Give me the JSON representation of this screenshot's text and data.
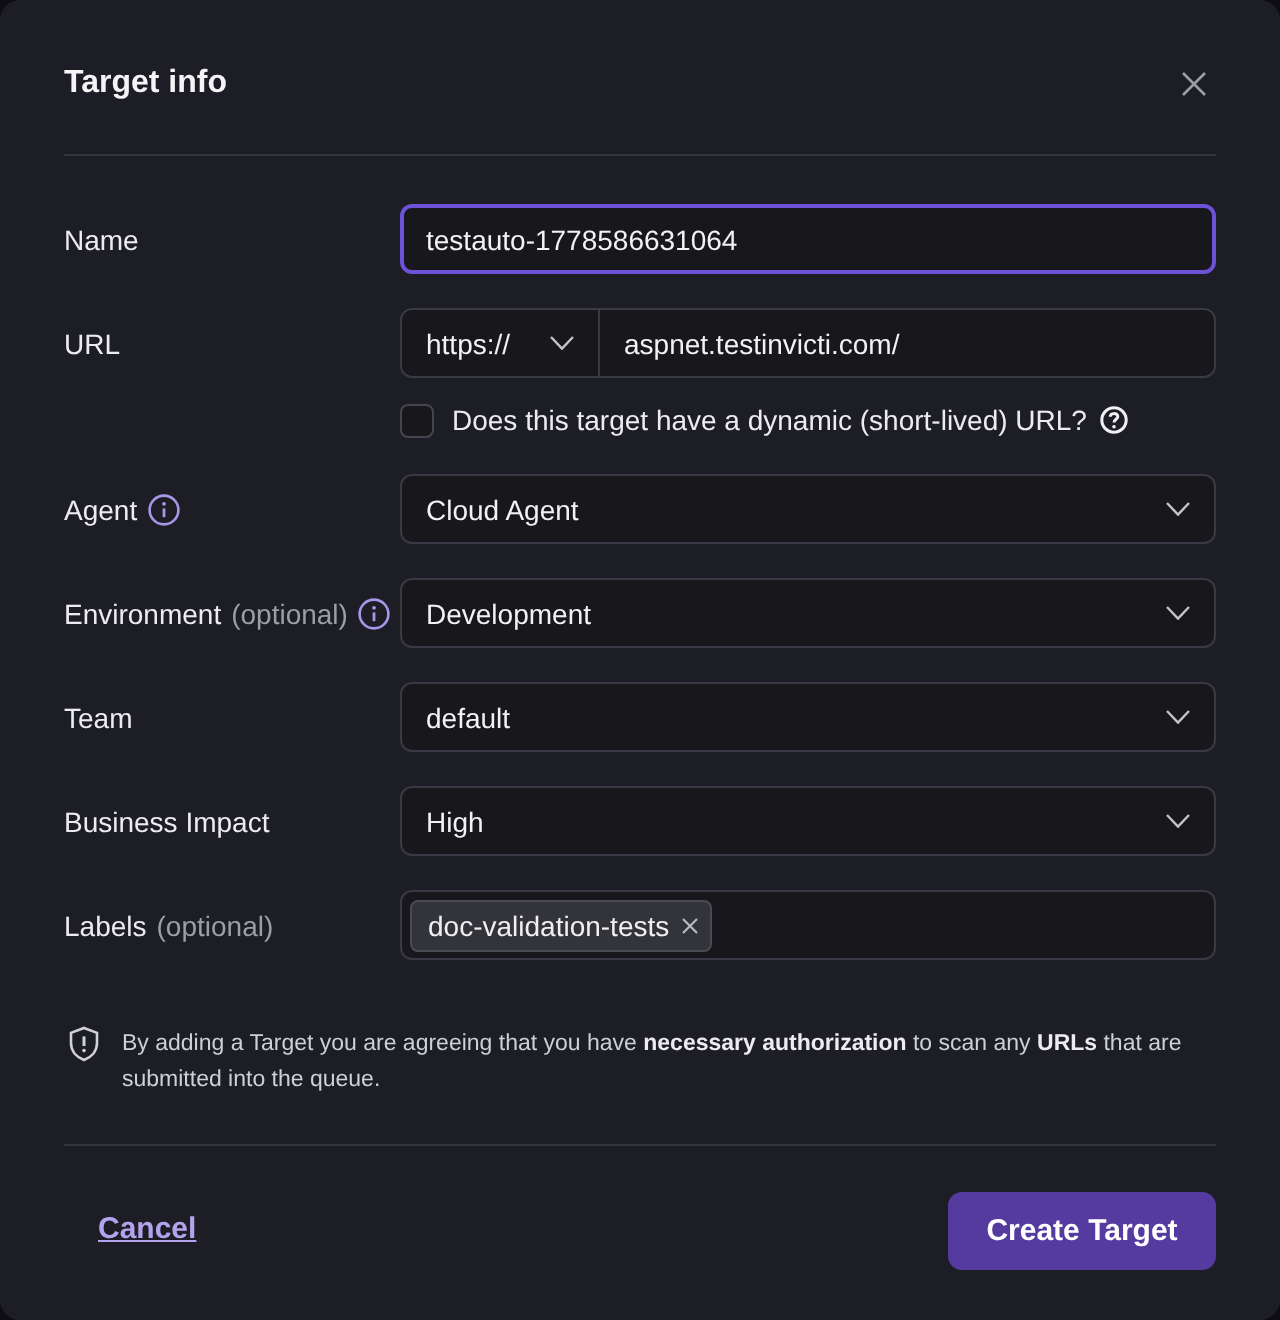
{
  "dialog": {
    "title": "Target info"
  },
  "fields": [
    {
      "kind": "text",
      "label": "Name",
      "info": false,
      "focused": true,
      "value": "testauto-1778586631064"
    },
    {
      "kind": "url",
      "label": "URL",
      "info": false,
      "focused": false,
      "scheme": "https://",
      "value": "aspnet.testinvicti.com/",
      "option": {
        "label": "Does this target have a dynamic (short-lived) URL?",
        "checked": false
      }
    },
    {
      "kind": "select",
      "label": "Agent",
      "info": true,
      "focused": false,
      "value": "Cloud Agent"
    },
    {
      "kind": "select",
      "label": "Environment",
      "hint": "(optional)",
      "info": true,
      "focused": false,
      "value": "Development"
    },
    {
      "kind": "select",
      "label": "Team",
      "info": false,
      "focused": false,
      "value": "default"
    },
    {
      "kind": "select",
      "label": "Business Impact",
      "info": false,
      "focused": false,
      "value": "High"
    },
    {
      "kind": "tags",
      "label": "Labels",
      "hint": "(optional)",
      "info": false,
      "focused": false,
      "tags": [
        "doc-validation-tests"
      ]
    }
  ],
  "notice": "By adding a Target you are agreeing that you have **necessary authorization** to scan any **URLs** that are submitted into the queue.",
  "footer": {
    "cancel": "Cancel",
    "submit": "Create Target"
  }
}
